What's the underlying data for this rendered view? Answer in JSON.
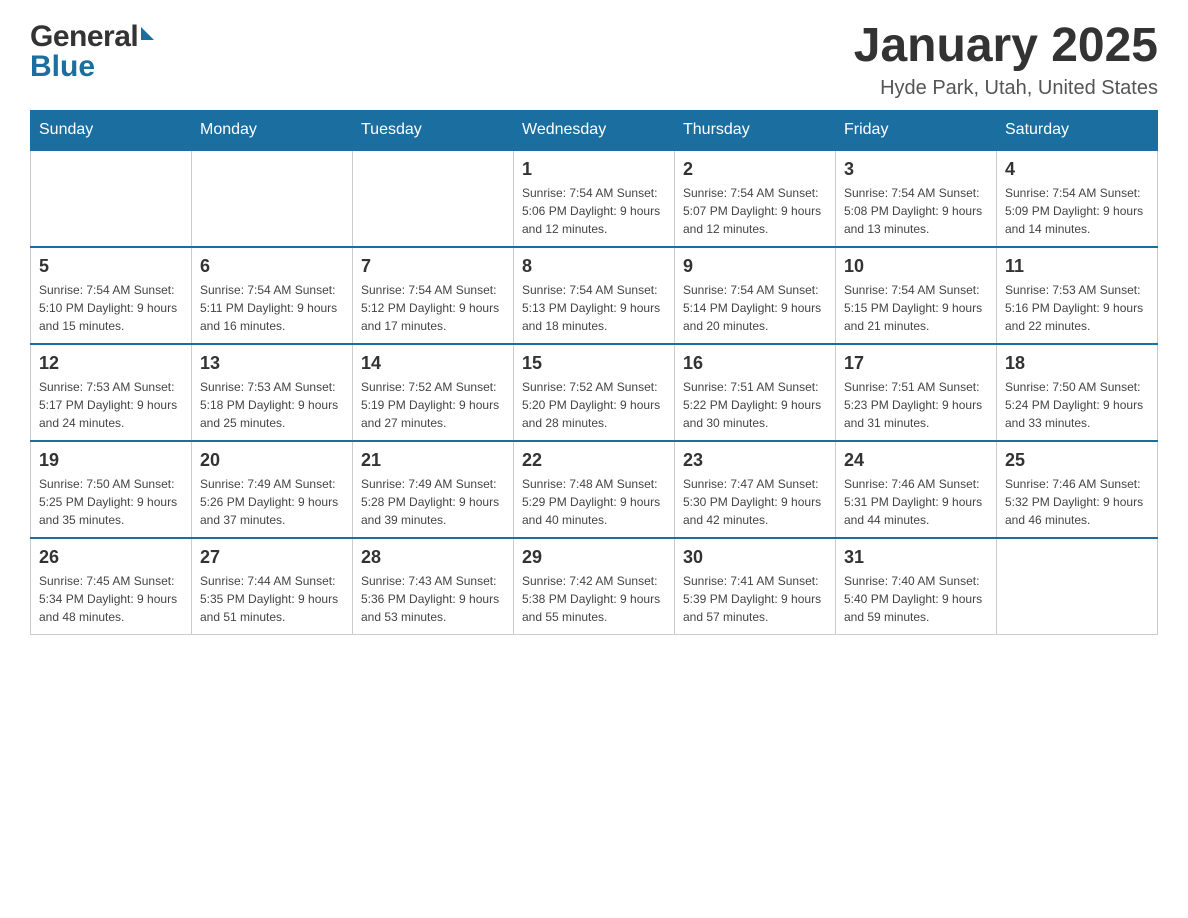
{
  "header": {
    "logo_general": "General",
    "logo_blue": "Blue",
    "title": "January 2025",
    "location": "Hyde Park, Utah, United States"
  },
  "weekdays": [
    "Sunday",
    "Monday",
    "Tuesday",
    "Wednesday",
    "Thursday",
    "Friday",
    "Saturday"
  ],
  "weeks": [
    [
      {
        "day": "",
        "info": ""
      },
      {
        "day": "",
        "info": ""
      },
      {
        "day": "",
        "info": ""
      },
      {
        "day": "1",
        "info": "Sunrise: 7:54 AM\nSunset: 5:06 PM\nDaylight: 9 hours\nand 12 minutes."
      },
      {
        "day": "2",
        "info": "Sunrise: 7:54 AM\nSunset: 5:07 PM\nDaylight: 9 hours\nand 12 minutes."
      },
      {
        "day": "3",
        "info": "Sunrise: 7:54 AM\nSunset: 5:08 PM\nDaylight: 9 hours\nand 13 minutes."
      },
      {
        "day": "4",
        "info": "Sunrise: 7:54 AM\nSunset: 5:09 PM\nDaylight: 9 hours\nand 14 minutes."
      }
    ],
    [
      {
        "day": "5",
        "info": "Sunrise: 7:54 AM\nSunset: 5:10 PM\nDaylight: 9 hours\nand 15 minutes."
      },
      {
        "day": "6",
        "info": "Sunrise: 7:54 AM\nSunset: 5:11 PM\nDaylight: 9 hours\nand 16 minutes."
      },
      {
        "day": "7",
        "info": "Sunrise: 7:54 AM\nSunset: 5:12 PM\nDaylight: 9 hours\nand 17 minutes."
      },
      {
        "day": "8",
        "info": "Sunrise: 7:54 AM\nSunset: 5:13 PM\nDaylight: 9 hours\nand 18 minutes."
      },
      {
        "day": "9",
        "info": "Sunrise: 7:54 AM\nSunset: 5:14 PM\nDaylight: 9 hours\nand 20 minutes."
      },
      {
        "day": "10",
        "info": "Sunrise: 7:54 AM\nSunset: 5:15 PM\nDaylight: 9 hours\nand 21 minutes."
      },
      {
        "day": "11",
        "info": "Sunrise: 7:53 AM\nSunset: 5:16 PM\nDaylight: 9 hours\nand 22 minutes."
      }
    ],
    [
      {
        "day": "12",
        "info": "Sunrise: 7:53 AM\nSunset: 5:17 PM\nDaylight: 9 hours\nand 24 minutes."
      },
      {
        "day": "13",
        "info": "Sunrise: 7:53 AM\nSunset: 5:18 PM\nDaylight: 9 hours\nand 25 minutes."
      },
      {
        "day": "14",
        "info": "Sunrise: 7:52 AM\nSunset: 5:19 PM\nDaylight: 9 hours\nand 27 minutes."
      },
      {
        "day": "15",
        "info": "Sunrise: 7:52 AM\nSunset: 5:20 PM\nDaylight: 9 hours\nand 28 minutes."
      },
      {
        "day": "16",
        "info": "Sunrise: 7:51 AM\nSunset: 5:22 PM\nDaylight: 9 hours\nand 30 minutes."
      },
      {
        "day": "17",
        "info": "Sunrise: 7:51 AM\nSunset: 5:23 PM\nDaylight: 9 hours\nand 31 minutes."
      },
      {
        "day": "18",
        "info": "Sunrise: 7:50 AM\nSunset: 5:24 PM\nDaylight: 9 hours\nand 33 minutes."
      }
    ],
    [
      {
        "day": "19",
        "info": "Sunrise: 7:50 AM\nSunset: 5:25 PM\nDaylight: 9 hours\nand 35 minutes."
      },
      {
        "day": "20",
        "info": "Sunrise: 7:49 AM\nSunset: 5:26 PM\nDaylight: 9 hours\nand 37 minutes."
      },
      {
        "day": "21",
        "info": "Sunrise: 7:49 AM\nSunset: 5:28 PM\nDaylight: 9 hours\nand 39 minutes."
      },
      {
        "day": "22",
        "info": "Sunrise: 7:48 AM\nSunset: 5:29 PM\nDaylight: 9 hours\nand 40 minutes."
      },
      {
        "day": "23",
        "info": "Sunrise: 7:47 AM\nSunset: 5:30 PM\nDaylight: 9 hours\nand 42 minutes."
      },
      {
        "day": "24",
        "info": "Sunrise: 7:46 AM\nSunset: 5:31 PM\nDaylight: 9 hours\nand 44 minutes."
      },
      {
        "day": "25",
        "info": "Sunrise: 7:46 AM\nSunset: 5:32 PM\nDaylight: 9 hours\nand 46 minutes."
      }
    ],
    [
      {
        "day": "26",
        "info": "Sunrise: 7:45 AM\nSunset: 5:34 PM\nDaylight: 9 hours\nand 48 minutes."
      },
      {
        "day": "27",
        "info": "Sunrise: 7:44 AM\nSunset: 5:35 PM\nDaylight: 9 hours\nand 51 minutes."
      },
      {
        "day": "28",
        "info": "Sunrise: 7:43 AM\nSunset: 5:36 PM\nDaylight: 9 hours\nand 53 minutes."
      },
      {
        "day": "29",
        "info": "Sunrise: 7:42 AM\nSunset: 5:38 PM\nDaylight: 9 hours\nand 55 minutes."
      },
      {
        "day": "30",
        "info": "Sunrise: 7:41 AM\nSunset: 5:39 PM\nDaylight: 9 hours\nand 57 minutes."
      },
      {
        "day": "31",
        "info": "Sunrise: 7:40 AM\nSunset: 5:40 PM\nDaylight: 9 hours\nand 59 minutes."
      },
      {
        "day": "",
        "info": ""
      }
    ]
  ]
}
